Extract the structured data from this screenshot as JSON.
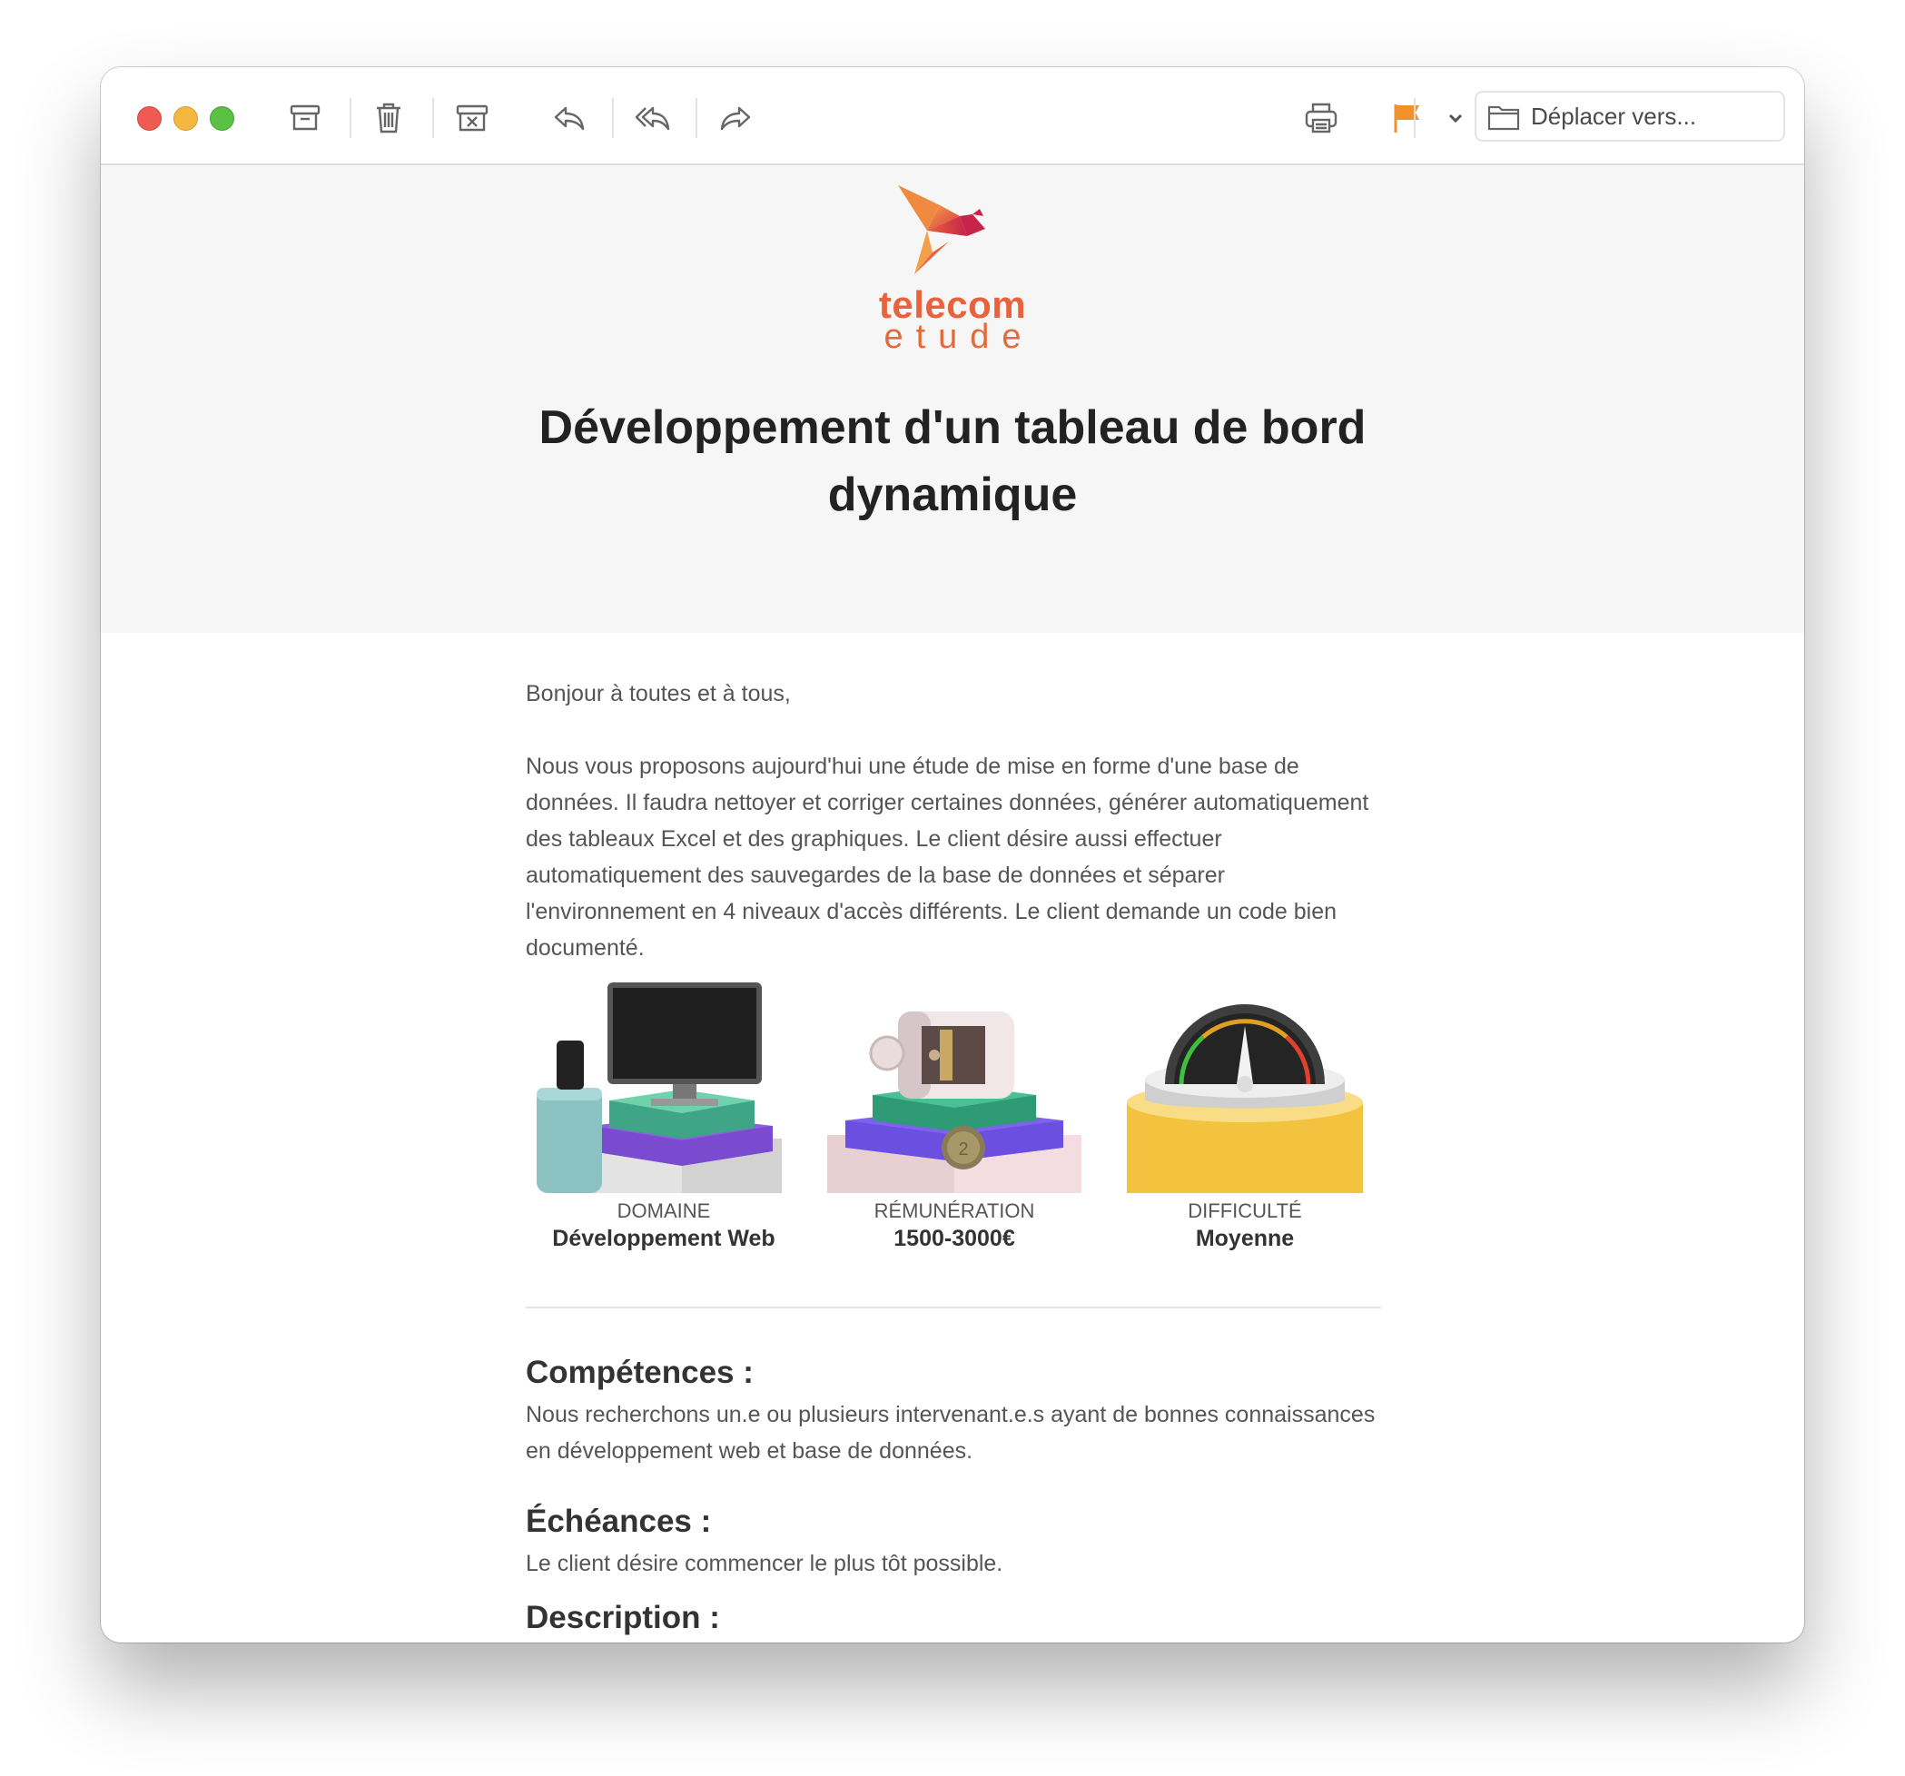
{
  "toolbar": {
    "move_to_placeholder": "Déplacer vers...",
    "flag_color": "#f0922c"
  },
  "logo": {
    "line1": "telecom",
    "line2": "etude",
    "colors": [
      "#f4a04a",
      "#e8623c",
      "#c8234a"
    ]
  },
  "email": {
    "title": "Développement d'un tableau de bord dynamique",
    "greeting": "Bonjour à toutes et à tous,",
    "intro": "Nous vous proposons aujourd'hui une étude de mise en forme d'une base de données. Il faudra nettoyer et corriger certaines données, générer automatiquement des tableaux Excel et des graphiques. Le client désire aussi effectuer automatiquement des sauvegardes de la base de données et séparer l'environnement en 4 niveaux d'accès différents. Le client demande un code bien documenté.",
    "cards": [
      {
        "label": "DOMAINE",
        "value": "Développement Web",
        "icon": "computer-illustration"
      },
      {
        "label": "RÉMUNÉRATION",
        "value": "1500-3000€",
        "icon": "safe-illustration"
      },
      {
        "label": "DIFFICULTÉ",
        "value": "Moyenne",
        "icon": "gauge-illustration"
      }
    ],
    "sections": [
      {
        "title": "Compétences :",
        "text": "Nous recherchons un.e ou plusieurs intervenant.e.s ayant de bonnes connaissances en développement web et base de données."
      },
      {
        "title": "Échéances :",
        "text": "Le client désire commencer le plus tôt possible."
      },
      {
        "title": "Description :",
        "text": ""
      }
    ]
  }
}
